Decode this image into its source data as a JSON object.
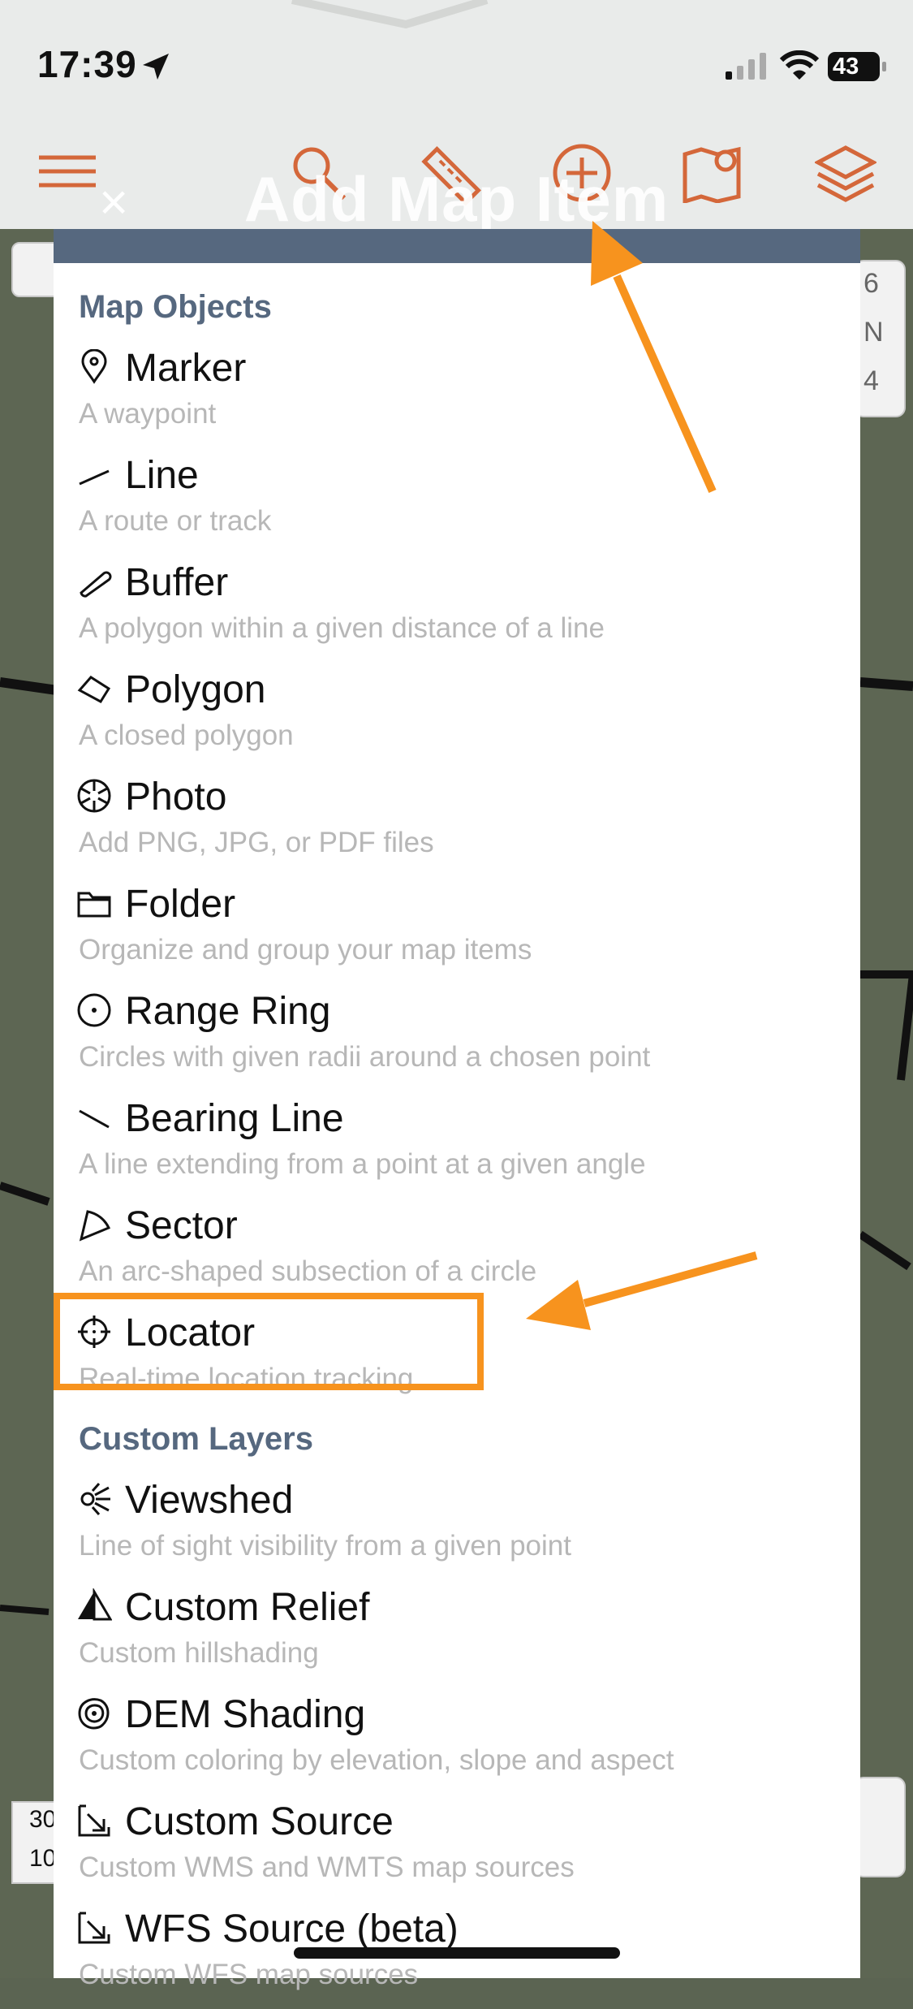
{
  "status_bar": {
    "time": "17:39",
    "battery": "43"
  },
  "toolbar": {
    "title": "Add Map Item",
    "close": "×",
    "icons": [
      "menu-icon",
      "search-icon",
      "ruler-icon",
      "add-circle-icon",
      "map-pin-icon",
      "layers-icon"
    ],
    "accent_color": "#d4673a"
  },
  "menu": {
    "sections": [
      {
        "title": "Map Objects",
        "items": [
          {
            "icon": "marker-icon",
            "label": "Marker",
            "desc": "A waypoint"
          },
          {
            "icon": "line-icon",
            "label": "Line",
            "desc": "A route or track"
          },
          {
            "icon": "buffer-icon",
            "label": "Buffer",
            "desc": "A polygon within a given distance of a line"
          },
          {
            "icon": "polygon-icon",
            "label": "Polygon",
            "desc": "A closed polygon"
          },
          {
            "icon": "photo-icon",
            "label": "Photo",
            "desc": "Add PNG, JPG, or PDF files"
          },
          {
            "icon": "folder-icon",
            "label": "Folder",
            "desc": "Organize and group your map items"
          },
          {
            "icon": "range-ring-icon",
            "label": "Range Ring",
            "desc": "Circles with given radii around a chosen point"
          },
          {
            "icon": "bearing-line-icon",
            "label": "Bearing Line",
            "desc": "A line extending from a point at a given angle"
          },
          {
            "icon": "sector-icon",
            "label": "Sector",
            "desc": "An arc-shaped subsection of a circle"
          },
          {
            "icon": "locator-icon",
            "label": "Locator",
            "desc": "Real-time location tracking"
          }
        ]
      },
      {
        "title": "Custom Layers",
        "items": [
          {
            "icon": "viewshed-icon",
            "label": "Viewshed",
            "desc": "Line of sight visibility from a given point"
          },
          {
            "icon": "custom-relief-icon",
            "label": "Custom Relief",
            "desc": "Custom hillshading"
          },
          {
            "icon": "dem-shading-icon",
            "label": "DEM Shading",
            "desc": "Custom coloring by elevation, slope and aspect"
          },
          {
            "icon": "custom-source-icon",
            "label": "Custom Source",
            "desc": "Custom WMS and WMTS map sources"
          },
          {
            "icon": "wfs-source-icon",
            "label": "WFS Source (beta)",
            "desc": "Custom WFS map sources"
          }
        ]
      }
    ]
  },
  "side_chips": {
    "right_top": [
      "6",
      "N",
      "4"
    ],
    "left_bottom": [
      "30",
      "10"
    ]
  },
  "annotation_color": "#f7931e"
}
